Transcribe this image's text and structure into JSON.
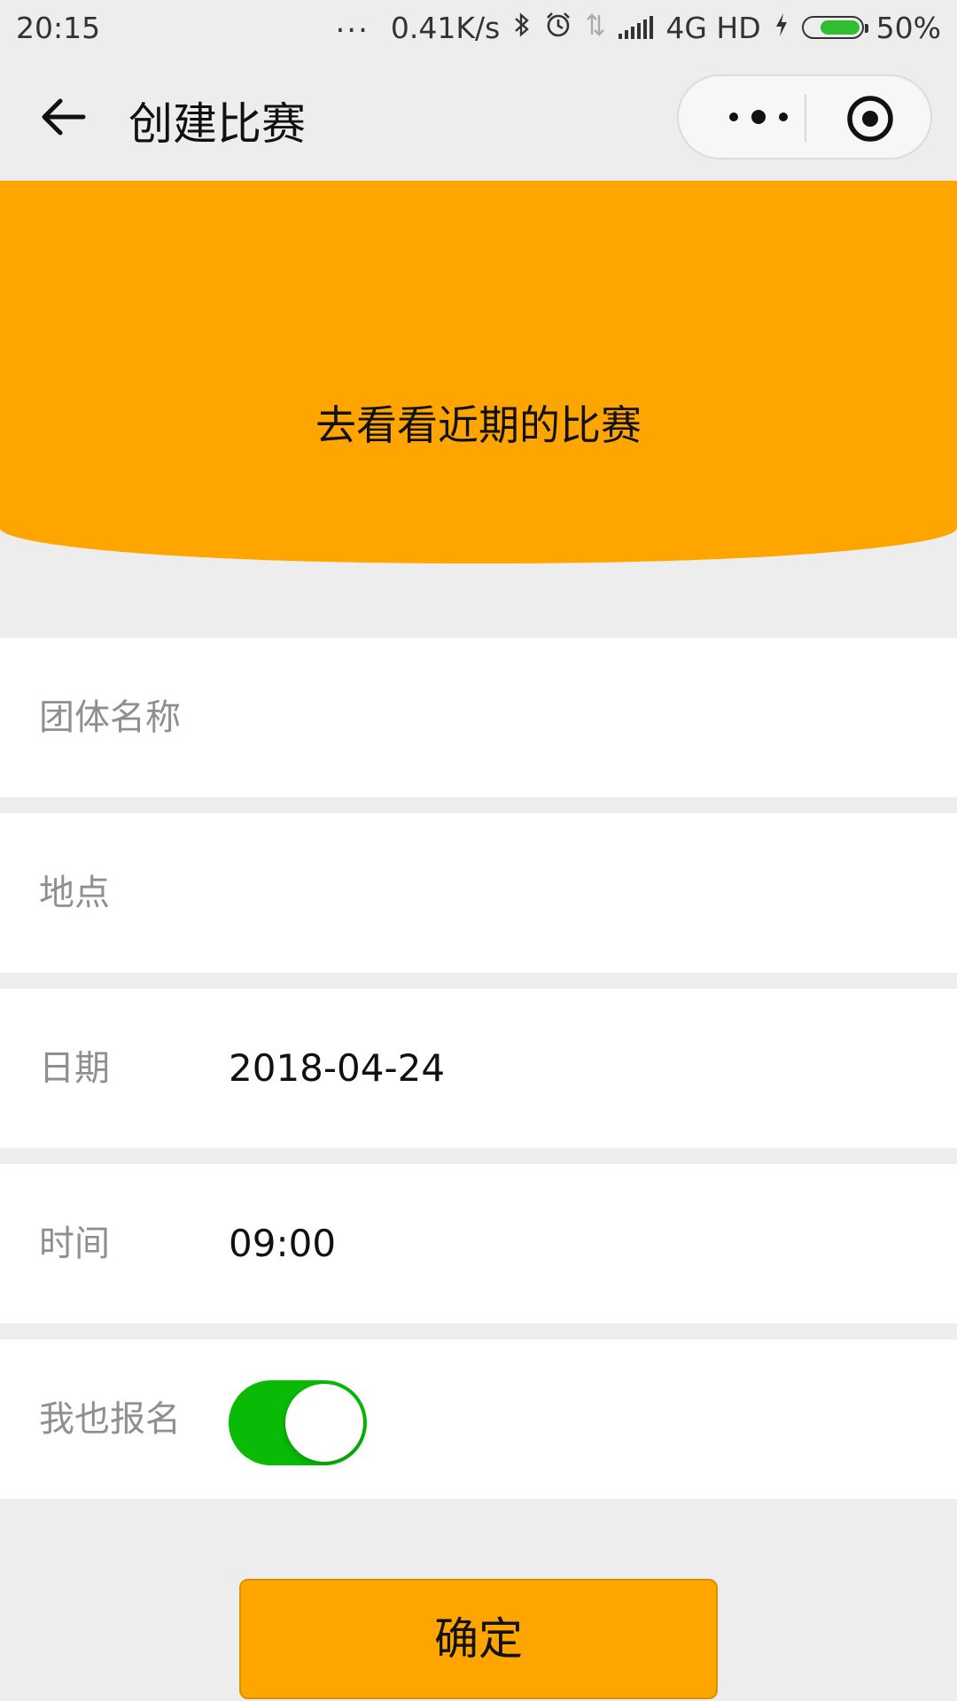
{
  "status_bar": {
    "time": "20:15",
    "dots": "...",
    "speed": "0.41K/s",
    "network": "4G HD",
    "battery": "50%",
    "battery_level_percent": 50,
    "icons": [
      "bluetooth-icon",
      "alarm-icon",
      "data-arrows-icon",
      "signal-icon",
      "charging-icon",
      "battery-icon"
    ]
  },
  "nav": {
    "title": "创建比赛",
    "back_icon": "arrow-left-icon",
    "menu_icon": "more-dots-icon",
    "close_icon": "target-close-icon"
  },
  "banner": {
    "text": "去看看近期的比赛",
    "color": "#ffa500"
  },
  "form": {
    "team_name": {
      "label": "团体名称",
      "value": ""
    },
    "location": {
      "label": "地点",
      "value": ""
    },
    "date": {
      "label": "日期",
      "value": "2018-04-24"
    },
    "time": {
      "label": "时间",
      "value": "09:00"
    },
    "signup": {
      "label": "我也报名",
      "on": true,
      "color": "#09bb07"
    }
  },
  "confirm": {
    "label": "确定",
    "color": "#ffa500"
  }
}
